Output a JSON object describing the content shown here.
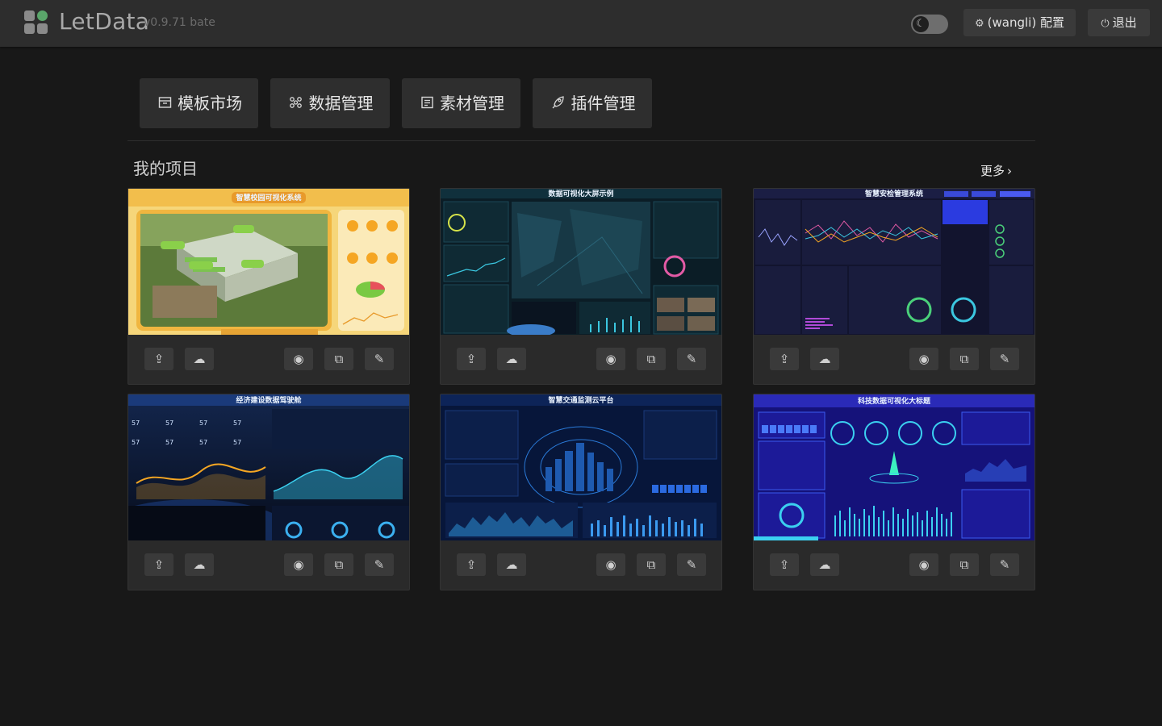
{
  "header": {
    "app_name": "LetData",
    "version": "v0.9.71 bate",
    "theme_toggle_icon": "moon-icon",
    "config_label": "(wangli) 配置",
    "logout_label": "退出"
  },
  "nav": [
    {
      "label": "模板市场",
      "icon": "store-icon"
    },
    {
      "label": "数据管理",
      "icon": "data-icon"
    },
    {
      "label": "素材管理",
      "icon": "material-icon"
    },
    {
      "label": "插件管理",
      "icon": "rocket-icon"
    }
  ],
  "projects": {
    "title": "我的项目",
    "more_label": "更多",
    "cards": [
      {
        "title": "智慧校园可视化系统",
        "theme": "#f4c552"
      },
      {
        "title": "数据可视化大屏示例",
        "theme": "#0f2630"
      },
      {
        "title": "智慧安检管理系统",
        "theme": "#151836"
      },
      {
        "title": "经济建设数据驾驶舱",
        "theme": "#0c1a35"
      },
      {
        "title": "智慧交通监测云平台",
        "theme": "#0b1a3e"
      },
      {
        "title": "科技数据可视化大标题",
        "theme": "#1a1a8c"
      }
    ],
    "action_icons": [
      "upload-cloud-icon",
      "download-cloud-icon",
      "eye-icon",
      "copy-icon",
      "edit-icon"
    ]
  }
}
